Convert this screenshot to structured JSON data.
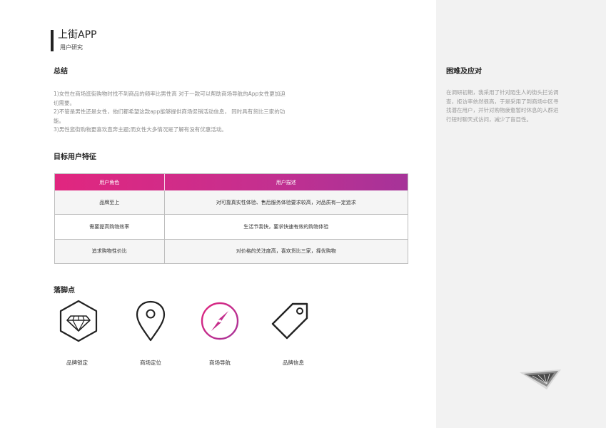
{
  "header": {
    "title": "上街APP",
    "subtitle": "用户研究"
  },
  "summary": {
    "heading": "总结",
    "lines": [
      "1)女性在商场逛街购物时找不到商品的频率比男性高 对于一款可以帮助商场导航的App女性更加迫切需要。",
      "2)不管是男性还是女性，他们都希望这款app能够提供商场促销活动信息， 同时具有货比三家的功能。",
      "3)男性逛街购物更喜欢直奔主题;而女性大多情况是了解有没有优惠活动。"
    ]
  },
  "target_users": {
    "heading": "目标用户特征",
    "columns": [
      "用户角色",
      "用户描述"
    ],
    "rows": [
      [
        "品牌至上",
        "对可靠真实性体验、售后服务体验要求较高，对品质有一定追求"
      ],
      [
        "需要提高购物效率",
        "生活节奏快，要求快速有效的购物体验"
      ],
      [
        "追求购物性价比",
        "对价格的关注度高，喜欢货比三家，择优购物"
      ]
    ],
    "header_gradient": [
      "#e1267f",
      "#a63399"
    ]
  },
  "features": {
    "heading": "落脚点",
    "items": [
      {
        "label": "品牌锁定",
        "icon": "diamond-hexagon-icon"
      },
      {
        "label": "商场定位",
        "icon": "location-pin-icon"
      },
      {
        "label": "商场导航",
        "icon": "compass-icon"
      },
      {
        "label": "品牌信息",
        "icon": "price-tag-icon"
      }
    ]
  },
  "difficulties": {
    "heading": "困难及应对",
    "text": "在调研初期，我采用了针对陌生人的街头拦访调查，拒访率依然很高，于是采用了到商场中区寻找潜在用户，并针对购物疲惫暂时休息的人群进行短时聊天式访问，减少了盲目性。"
  },
  "colors": {
    "accent_pink": "#e1267f",
    "accent_purple": "#a63399",
    "panel_background": "#f2f2f2"
  }
}
